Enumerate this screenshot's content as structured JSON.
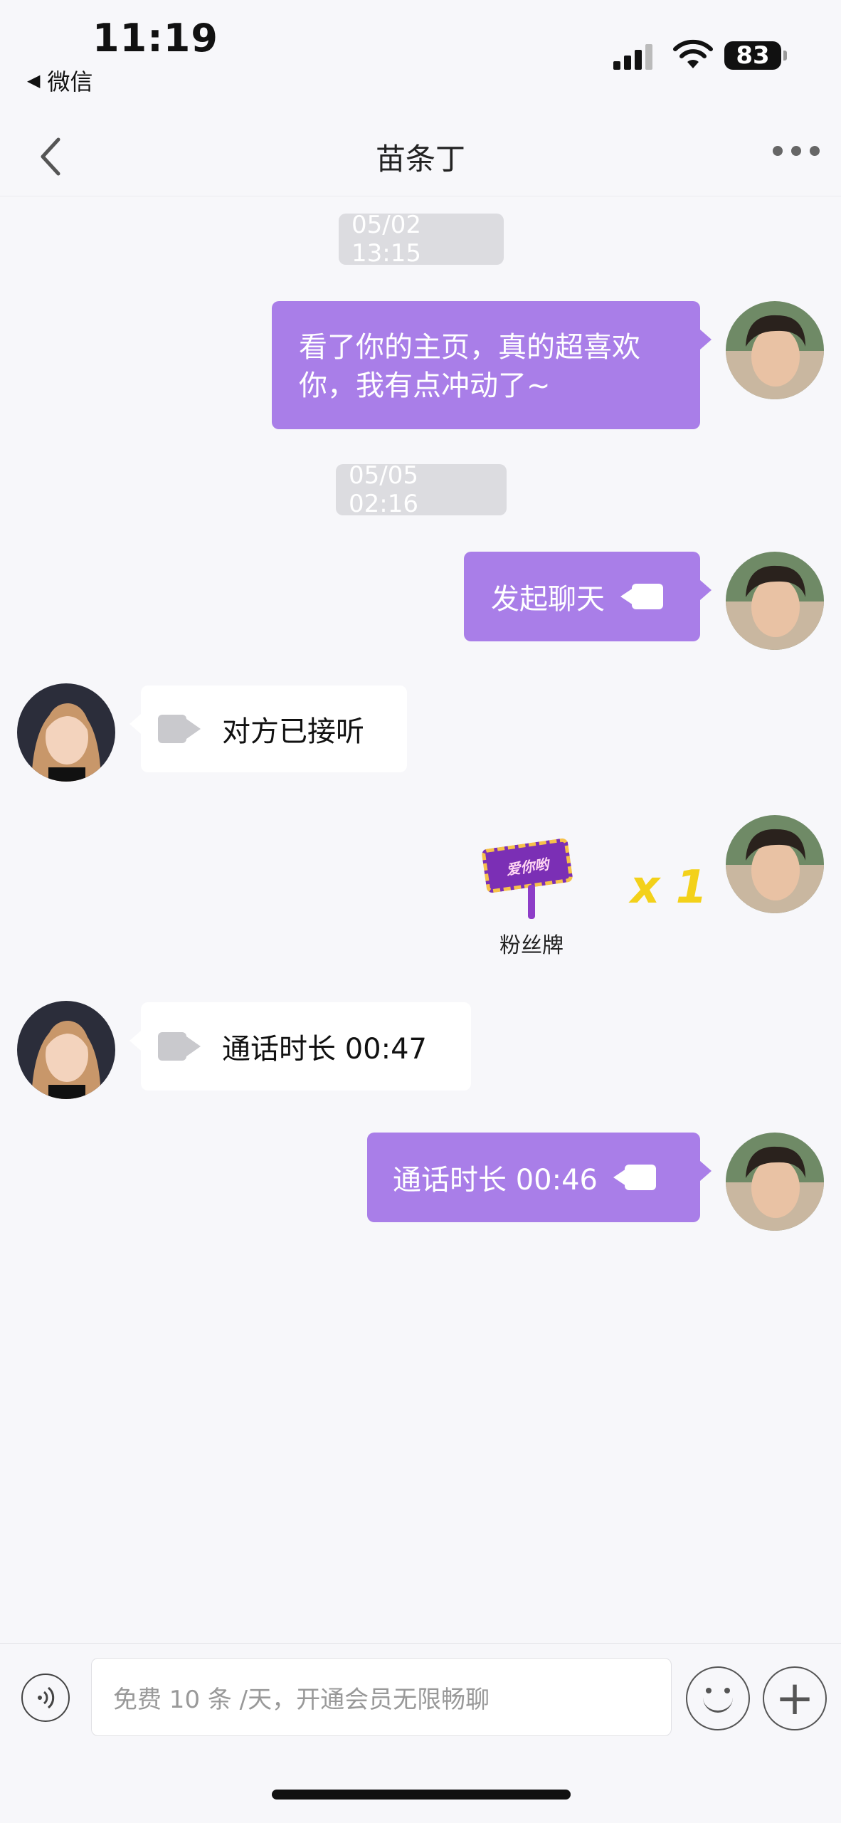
{
  "status_bar": {
    "time": "11:19",
    "back_app": "微信",
    "battery": "83"
  },
  "nav": {
    "title": "苗条丁"
  },
  "timestamps": [
    "05/02 13:15",
    "05/05 02:16"
  ],
  "messages": [
    {
      "side": "me",
      "text": "看了你的主页，真的超喜欢你，我有点冲动了~"
    },
    {
      "side": "me",
      "text": "发起聊天",
      "icon": "video-camera-icon"
    },
    {
      "side": "other",
      "text": "对方已接听",
      "icon": "video-camera-icon"
    },
    {
      "side": "me",
      "gift": {
        "sign_text": "爱你哟",
        "label": "粉丝牌",
        "count": "x 1"
      }
    },
    {
      "side": "other",
      "text": "通话时长 00:47",
      "icon": "video-camera-icon"
    },
    {
      "side": "me",
      "text": "通话时长 00:46",
      "icon": "video-camera-icon"
    }
  ],
  "input": {
    "placeholder": "免费 10 条 /天，开通会员无限畅聊"
  },
  "colors": {
    "my_bubble": "#a97ee8",
    "other_bubble": "#ffffff",
    "background": "#f7f7fa",
    "gift_count": "#f3d11a"
  }
}
